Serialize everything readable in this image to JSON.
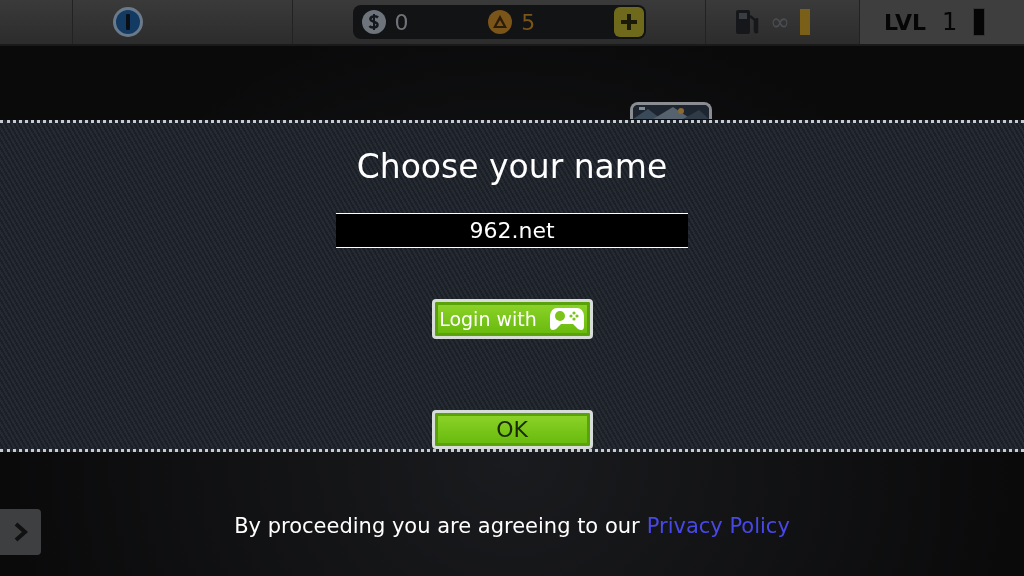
{
  "top_bar": {
    "currency": [
      {
        "kind": "cash",
        "amount": "0"
      },
      {
        "kind": "gold",
        "amount": "5"
      }
    ],
    "fuel": {
      "amount": "∞",
      "level": 1
    },
    "player_level": {
      "label": "LVL",
      "value": "1"
    }
  },
  "dialog": {
    "title": "Choose your name",
    "name_field": {
      "value": "962.net"
    },
    "buttons": [
      {
        "kind": "login",
        "label": "Login with"
      },
      {
        "kind": "ok",
        "label": "OK"
      }
    ]
  },
  "footer": {
    "text": "By proceeding you are agreeing to our",
    "link": "Privacy Policy"
  }
}
